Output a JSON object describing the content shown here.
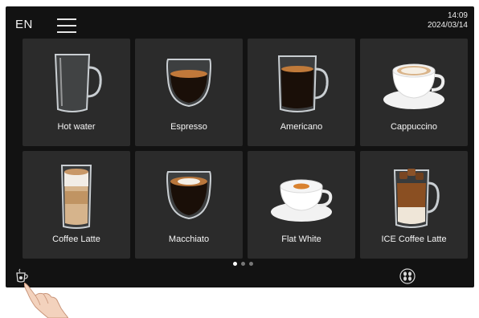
{
  "header": {
    "language": "EN",
    "time": "14:09",
    "date": "2024/03/14"
  },
  "drinks": [
    {
      "label": "Hot water",
      "icon": "hot-water-cup-icon"
    },
    {
      "label": "Espresso",
      "icon": "espresso-cup-icon"
    },
    {
      "label": "Americano",
      "icon": "americano-cup-icon"
    },
    {
      "label": "Cappuccino",
      "icon": "cappuccino-cup-icon"
    },
    {
      "label": "Coffee Latte",
      "icon": "latte-glass-icon"
    },
    {
      "label": "Macchiato",
      "icon": "macchiato-cup-icon"
    },
    {
      "label": "Flat White",
      "icon": "flat-white-cup-icon"
    },
    {
      "label": "ICE Coffee Latte",
      "icon": "ice-latte-glass-icon"
    }
  ],
  "pagination": {
    "pages": 3,
    "current": 1
  },
  "footer": {
    "left_icon": "cup-settings-icon",
    "right_icon": "coffee-beans-icon"
  },
  "colors": {
    "screen": "#121212",
    "tile": "#2b2b2b",
    "text": "#f5f5f5",
    "dot_active": "#ffffff",
    "dot_inactive": "#777777"
  }
}
